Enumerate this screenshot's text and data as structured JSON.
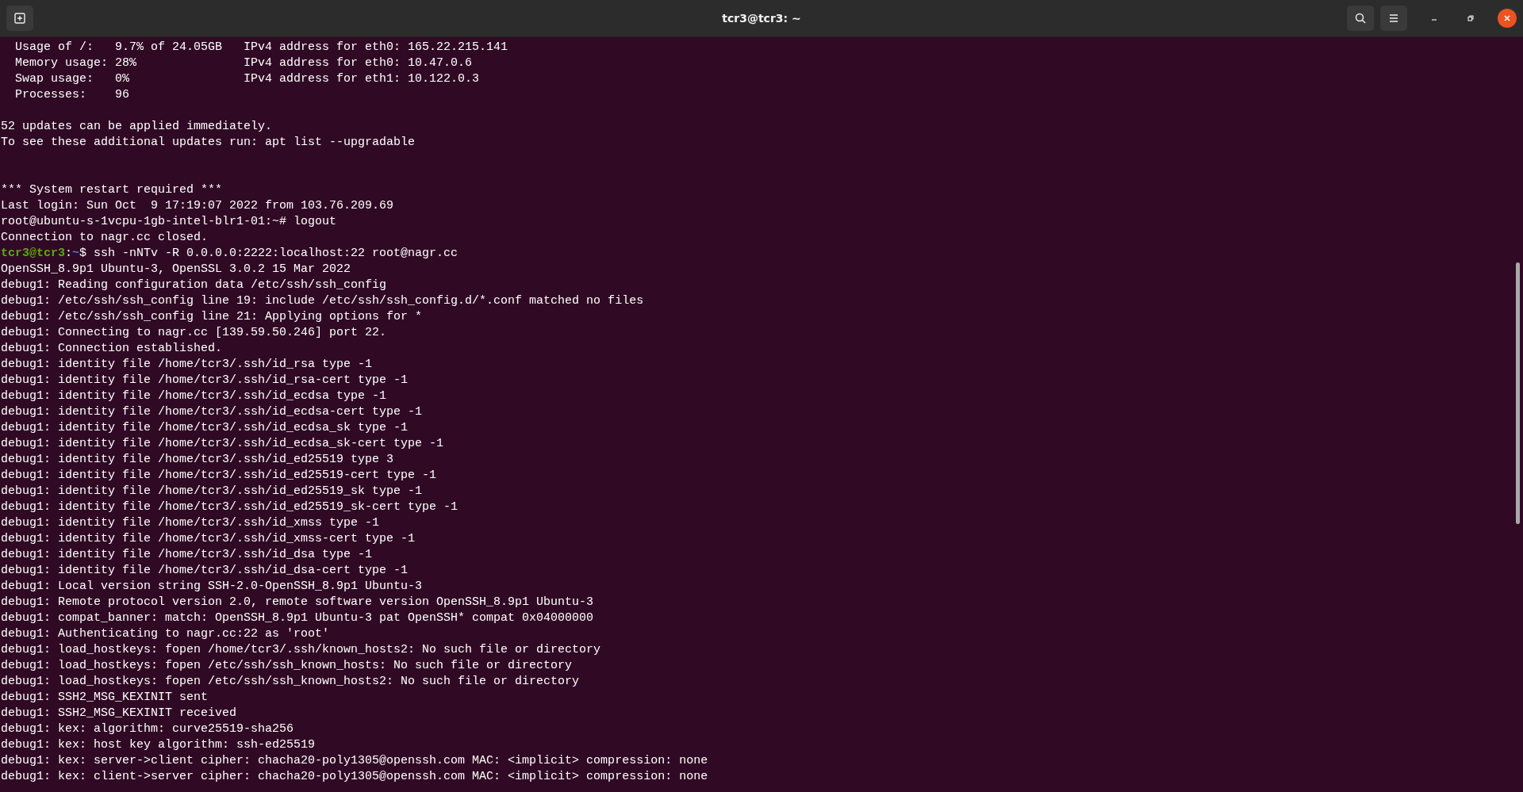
{
  "window": {
    "title": "tcr3@tcr3: ~"
  },
  "terminal": {
    "lines": [
      {
        "kind": "output",
        "text": "  Usage of /:   9.7% of 24.05GB   IPv4 address for eth0: 165.22.215.141"
      },
      {
        "kind": "output",
        "text": "  Memory usage: 28%               IPv4 address for eth0: 10.47.0.6"
      },
      {
        "kind": "output",
        "text": "  Swap usage:   0%                IPv4 address for eth1: 10.122.0.3"
      },
      {
        "kind": "output",
        "text": "  Processes:    96"
      },
      {
        "kind": "blank"
      },
      {
        "kind": "output",
        "text": "52 updates can be applied immediately."
      },
      {
        "kind": "output",
        "text": "To see these additional updates run: apt list --upgradable"
      },
      {
        "kind": "blank"
      },
      {
        "kind": "blank"
      },
      {
        "kind": "output",
        "text": "*** System restart required ***"
      },
      {
        "kind": "output",
        "text": "Last login: Sun Oct  9 17:19:07 2022 from 103.76.209.69"
      },
      {
        "kind": "output",
        "text": "root@ubuntu-s-1vcpu-1gb-intel-blr1-01:~# logout"
      },
      {
        "kind": "output",
        "text": "Connection to nagr.cc closed."
      },
      {
        "kind": "prompt",
        "user_host": "tcr3@tcr3",
        "separator": ":",
        "path": "~",
        "command": "$ ssh -nNTv -R 0.0.0.0:2222:localhost:22 root@nagr.cc"
      },
      {
        "kind": "output",
        "text": "OpenSSH_8.9p1 Ubuntu-3, OpenSSL 3.0.2 15 Mar 2022"
      },
      {
        "kind": "output",
        "text": "debug1: Reading configuration data /etc/ssh/ssh_config"
      },
      {
        "kind": "output",
        "text": "debug1: /etc/ssh/ssh_config line 19: include /etc/ssh/ssh_config.d/*.conf matched no files"
      },
      {
        "kind": "output",
        "text": "debug1: /etc/ssh/ssh_config line 21: Applying options for *"
      },
      {
        "kind": "output",
        "text": "debug1: Connecting to nagr.cc [139.59.50.246] port 22."
      },
      {
        "kind": "output",
        "text": "debug1: Connection established."
      },
      {
        "kind": "output",
        "text": "debug1: identity file /home/tcr3/.ssh/id_rsa type -1"
      },
      {
        "kind": "output",
        "text": "debug1: identity file /home/tcr3/.ssh/id_rsa-cert type -1"
      },
      {
        "kind": "output",
        "text": "debug1: identity file /home/tcr3/.ssh/id_ecdsa type -1"
      },
      {
        "kind": "output",
        "text": "debug1: identity file /home/tcr3/.ssh/id_ecdsa-cert type -1"
      },
      {
        "kind": "output",
        "text": "debug1: identity file /home/tcr3/.ssh/id_ecdsa_sk type -1"
      },
      {
        "kind": "output",
        "text": "debug1: identity file /home/tcr3/.ssh/id_ecdsa_sk-cert type -1"
      },
      {
        "kind": "output",
        "text": "debug1: identity file /home/tcr3/.ssh/id_ed25519 type 3"
      },
      {
        "kind": "output",
        "text": "debug1: identity file /home/tcr3/.ssh/id_ed25519-cert type -1"
      },
      {
        "kind": "output",
        "text": "debug1: identity file /home/tcr3/.ssh/id_ed25519_sk type -1"
      },
      {
        "kind": "output",
        "text": "debug1: identity file /home/tcr3/.ssh/id_ed25519_sk-cert type -1"
      },
      {
        "kind": "output",
        "text": "debug1: identity file /home/tcr3/.ssh/id_xmss type -1"
      },
      {
        "kind": "output",
        "text": "debug1: identity file /home/tcr3/.ssh/id_xmss-cert type -1"
      },
      {
        "kind": "output",
        "text": "debug1: identity file /home/tcr3/.ssh/id_dsa type -1"
      },
      {
        "kind": "output",
        "text": "debug1: identity file /home/tcr3/.ssh/id_dsa-cert type -1"
      },
      {
        "kind": "output",
        "text": "debug1: Local version string SSH-2.0-OpenSSH_8.9p1 Ubuntu-3"
      },
      {
        "kind": "output",
        "text": "debug1: Remote protocol version 2.0, remote software version OpenSSH_8.9p1 Ubuntu-3"
      },
      {
        "kind": "output",
        "text": "debug1: compat_banner: match: OpenSSH_8.9p1 Ubuntu-3 pat OpenSSH* compat 0x04000000"
      },
      {
        "kind": "output",
        "text": "debug1: Authenticating to nagr.cc:22 as 'root'"
      },
      {
        "kind": "output",
        "text": "debug1: load_hostkeys: fopen /home/tcr3/.ssh/known_hosts2: No such file or directory"
      },
      {
        "kind": "output",
        "text": "debug1: load_hostkeys: fopen /etc/ssh/ssh_known_hosts: No such file or directory"
      },
      {
        "kind": "output",
        "text": "debug1: load_hostkeys: fopen /etc/ssh/ssh_known_hosts2: No such file or directory"
      },
      {
        "kind": "output",
        "text": "debug1: SSH2_MSG_KEXINIT sent"
      },
      {
        "kind": "output",
        "text": "debug1: SSH2_MSG_KEXINIT received"
      },
      {
        "kind": "output",
        "text": "debug1: kex: algorithm: curve25519-sha256"
      },
      {
        "kind": "output",
        "text": "debug1: kex: host key algorithm: ssh-ed25519"
      },
      {
        "kind": "output",
        "text": "debug1: kex: server->client cipher: chacha20-poly1305@openssh.com MAC: <implicit> compression: none"
      },
      {
        "kind": "output",
        "text": "debug1: kex: client->server cipher: chacha20-poly1305@openssh.com MAC: <implicit> compression: none"
      }
    ]
  }
}
